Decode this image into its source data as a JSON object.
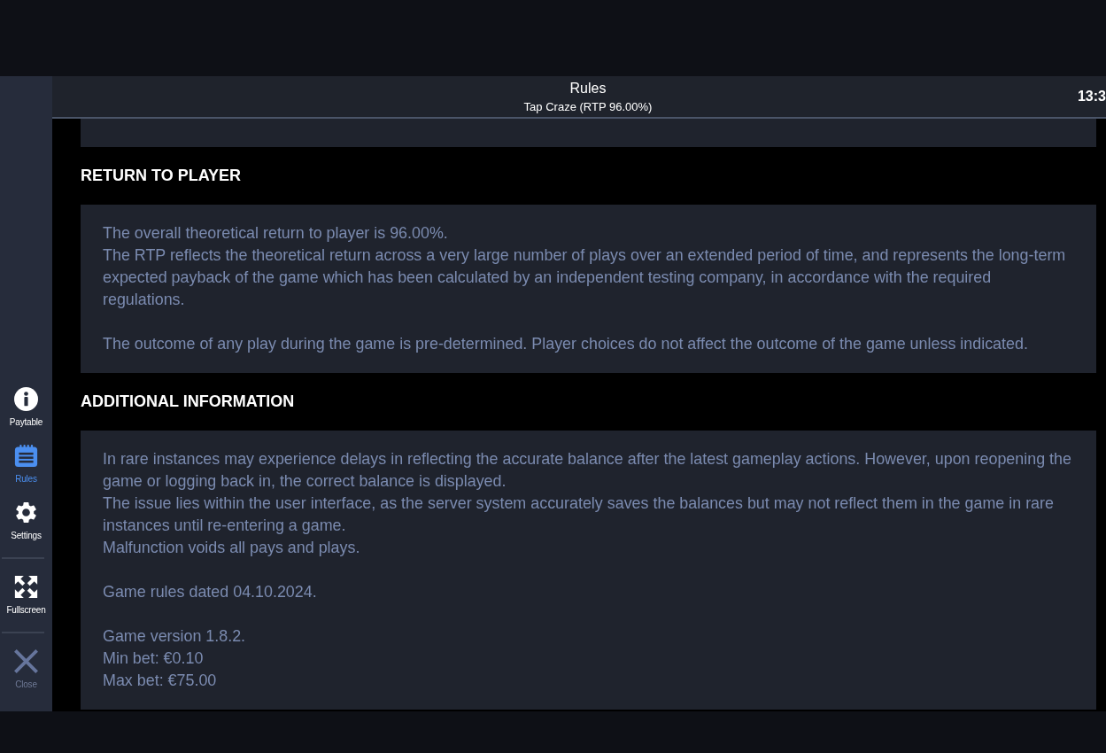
{
  "sidebar": {
    "groups": [
      [
        {
          "kind": "info",
          "label": "Paytable",
          "selected": false
        },
        {
          "kind": "rules",
          "label": "Rules",
          "selected": true
        },
        {
          "kind": "settings",
          "label": "Settings",
          "selected": false
        }
      ],
      [
        {
          "kind": "fullscreen",
          "label": "Fullscreen",
          "selected": false
        }
      ],
      [
        {
          "kind": "close",
          "label": "Close",
          "selected": false
        }
      ]
    ]
  },
  "header": {
    "title": "Rules",
    "subtitle": "Tap Craze (RTP 96.00%)",
    "clock": "13:3"
  },
  "content": {
    "sections": [
      {
        "heading": "RETURN TO PLAYER",
        "blocks": [
          [
            "The overall theoretical return to player is 96.00%.",
            "The RTP reflects the theoretical return across a very large number of plays over an extended period of time, and represents the long-term expected payback of the game which has been calculated by an independent testing company, in accordance with the required regulations."
          ],
          [
            "The outcome of any play during the game is pre-determined. Player choices do not affect the outcome of the game unless indicated."
          ]
        ]
      },
      {
        "heading": "ADDITIONAL INFORMATION",
        "blocks": [
          [
            "In rare instances may experience delays in reflecting the accurate balance after the latest gameplay actions. However, upon reopening the game or logging back in, the correct balance is displayed.",
            "The issue lies within the user interface, as the server system accurately saves the balances but may not reflect them in the game in rare instances until re-entering a game.",
            "Malfunction voids all pays and plays."
          ],
          [
            "Game rules dated 04.10.2024."
          ],
          [
            "Game version 1.8.2.",
            "Min bet: €0.10",
            "Max bet: €75.00"
          ]
        ]
      }
    ]
  }
}
